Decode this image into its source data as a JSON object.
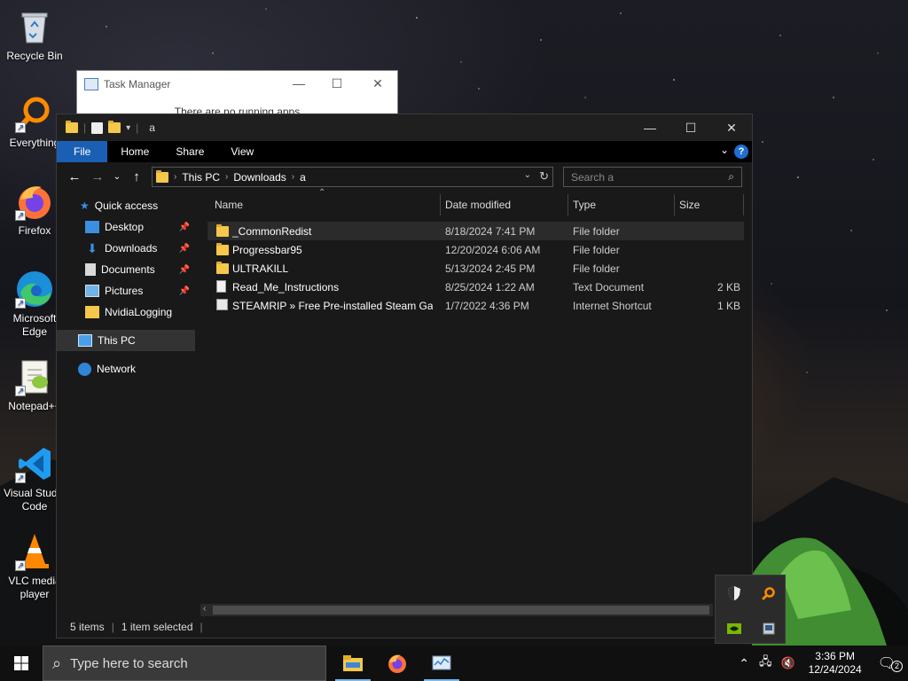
{
  "desktop": {
    "icons": [
      {
        "label": "Recycle Bin"
      },
      {
        "label": "Everything"
      },
      {
        "label": "Firefox"
      },
      {
        "label": "Microsoft Edge"
      },
      {
        "label": "Notepad++"
      },
      {
        "label": "Visual Studio Code"
      },
      {
        "label": "VLC media player"
      }
    ]
  },
  "task_manager": {
    "title": "Task Manager",
    "body_text": "There are no running apps"
  },
  "explorer": {
    "title": "a",
    "ribbon_tabs": [
      "File",
      "Home",
      "Share",
      "View"
    ],
    "breadcrumb": [
      "This PC",
      "Downloads",
      "a"
    ],
    "search_placeholder": "Search a",
    "columns": {
      "name": "Name",
      "date": "Date modified",
      "type": "Type",
      "size": "Size"
    },
    "nav": {
      "quick_access": "Quick access",
      "items": [
        "Desktop",
        "Downloads",
        "Documents",
        "Pictures",
        "NvidiaLogging"
      ],
      "this_pc": "This PC",
      "network": "Network"
    },
    "files": [
      {
        "name": "_CommonRedist",
        "date": "8/18/2024 7:41 PM",
        "type": "File folder",
        "size": "",
        "icon": "folder-icon"
      },
      {
        "name": "Progressbar95",
        "date": "12/20/2024 6:06 AM",
        "type": "File folder",
        "size": "",
        "icon": "folder-icon"
      },
      {
        "name": "ULTRAKILL",
        "date": "5/13/2024 2:45 PM",
        "type": "File folder",
        "size": "",
        "icon": "folder-icon"
      },
      {
        "name": "Read_Me_Instructions",
        "date": "8/25/2024 1:22 AM",
        "type": "Text Document",
        "size": "2 KB",
        "icon": "text-document-icon"
      },
      {
        "name": "STEAMRIP » Free Pre-installed Steam Ga...",
        "date": "1/7/2022 4:36 PM",
        "type": "Internet Shortcut",
        "size": "1 KB",
        "icon": "internet-shortcut-icon"
      }
    ],
    "status": {
      "items": "5 items",
      "selected": "1 item selected"
    }
  },
  "taskbar": {
    "search_placeholder": "Type here to search",
    "time": "3:36 PM",
    "date": "12/24/2024",
    "notification_count": "2"
  },
  "colors": {
    "file_tab": "#1a5fb4",
    "folder": "#f5c74a",
    "taskbar": "#101010",
    "explorer_bg": "#191919"
  }
}
